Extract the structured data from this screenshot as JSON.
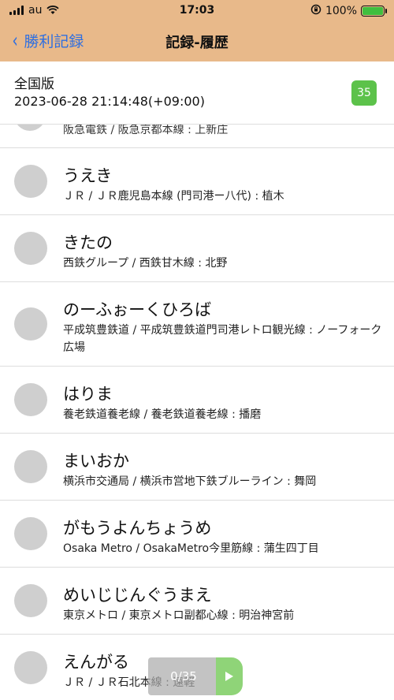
{
  "status_bar": {
    "carrier": "au",
    "time": "17:03",
    "battery": "100%"
  },
  "navbar": {
    "back_label": "勝利記録",
    "title": "記録-履歴"
  },
  "header": {
    "edition": "全国版",
    "datetime": "2023-06-28 21:14:48(+09:00)",
    "count": "35"
  },
  "list": {
    "cut_sub": "阪急電鉄 / 阪急京都本線 : 上新庄",
    "items": [
      {
        "title": "うえき",
        "sub": "ＪＲ / ＪＲ鹿児島本線 (門司港ー八代) : 植木"
      },
      {
        "title": "きたの",
        "sub": "西鉄グループ / 西鉄甘木線 : 北野"
      },
      {
        "title": "のーふぉーくひろば",
        "sub": "平成筑豊鉄道 / 平成筑豊鉄道門司港レトロ観光線 : ノーフォーク広場"
      },
      {
        "title": "はりま",
        "sub": "養老鉄道養老線 / 養老鉄道養老線 : 播磨"
      },
      {
        "title": "まいおか",
        "sub": "横浜市交通局 / 横浜市営地下鉄ブルーライン : 舞岡"
      },
      {
        "title": "がもうよんちょうめ",
        "sub": "Osaka Metro / OsakaMetro今里筋線 : 蒲生四丁目"
      },
      {
        "title": "めいじじんぐうまえ",
        "sub": "東京メトロ / 東京メトロ副都心線 : 明治神宮前"
      },
      {
        "title": "えんがる",
        "sub": "ＪＲ / ＪＲ石北本線 : 遠軽"
      }
    ]
  },
  "toast": {
    "text": "0/35"
  },
  "icons": {
    "back": "chevron-left-icon",
    "play": "play-icon",
    "signal": "signal-icon",
    "wifi": "wifi-icon",
    "battery": "battery-icon",
    "lock": "rotation-lock-icon"
  },
  "colors": {
    "top_bar": "#e8b98a",
    "back_link": "#2f6fe0",
    "badge": "#5cc24a",
    "play_button": "#8fd478"
  }
}
